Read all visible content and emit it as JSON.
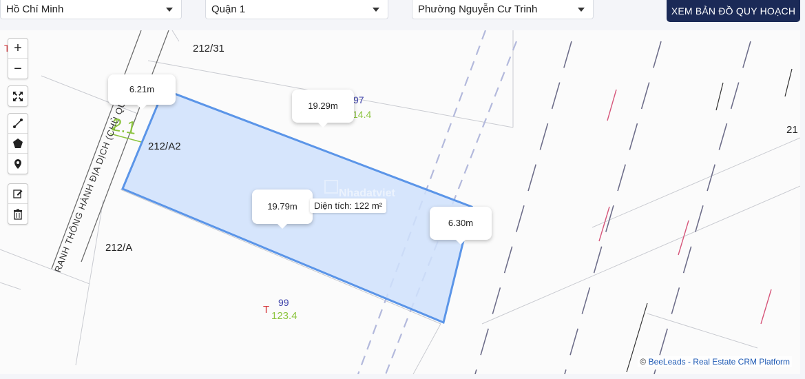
{
  "filters": {
    "city": "Hồ Chí Minh",
    "district": "Quận 1",
    "ward": "Phường Nguyễn Cư Trinh",
    "plan_button": "XEM BẢN ĐỒ QUY HOẠCH"
  },
  "map": {
    "parcel_labels": {
      "p212_31": "212/31",
      "p212_A2": "212/A2",
      "p212_A": "212/A",
      "p219": "21"
    },
    "road_label": "RANH THÔNG HÀNH ĐỊA DỊCH (CHỦ QUYỀN)",
    "number_2_1": "2.1",
    "lot_97": {
      "prefix": "T",
      "number": "97",
      "area": "14.4"
    },
    "lot_99": {
      "prefix": "T",
      "number": "99",
      "area": "123.4"
    },
    "top_left_marker": "T",
    "measurements": {
      "left_edge": "6.21m",
      "top_edge": "19.29m",
      "bottom_edge": "19.79m",
      "right_edge": "6.30m"
    },
    "area_label": "Diện tích: 122 m²",
    "watermark": "Nhadatviet"
  },
  "toolbar": {
    "zoom_in": "+",
    "zoom_out": "−",
    "icons": [
      "fullscreen-icon",
      "polyline-icon",
      "polygon-icon",
      "marker-icon",
      "edit-icon",
      "trash-icon"
    ]
  },
  "attribution": {
    "copyright": "©",
    "brand": "BeeLeads",
    "tagline": " - Real Estate CRM Platform"
  },
  "colors": {
    "parcel_fill": "#cfe0fb",
    "parcel_stroke": "#5b95e8",
    "button_bg": "#1b2a57"
  }
}
